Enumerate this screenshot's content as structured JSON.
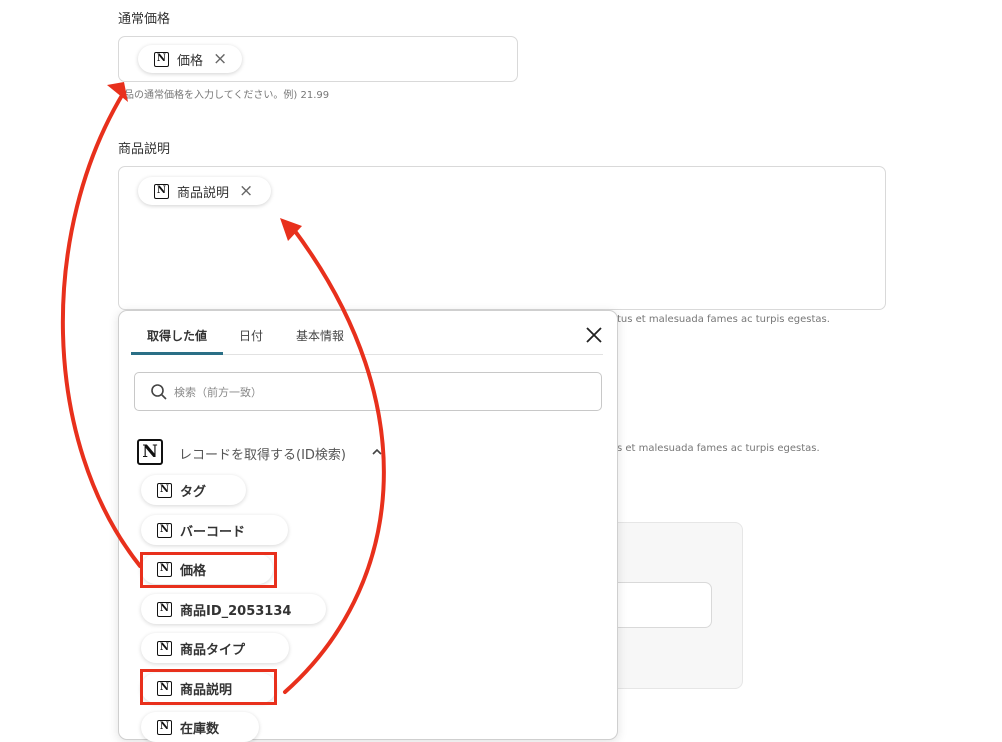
{
  "price_field": {
    "label": "通常価格",
    "chip": "価格",
    "hint": "品の通常価格を入力してください。例) 21.99"
  },
  "description_field": {
    "label": "商品説明",
    "chip": "商品説明",
    "hint": "tus et malesuada fames ac turpis egestas."
  },
  "background_hint_2": "s et malesuada fames ac turpis egestas.",
  "panel": {
    "tabs": [
      "取得した値",
      "日付",
      "基本情報"
    ],
    "search_placeholder": "検索（前方一致）",
    "section_title": "レコードを取得する(ID検索)",
    "items": [
      "タグ",
      "バーコード",
      "価格",
      "商品ID_2053134",
      "商品タイプ",
      "商品説明",
      "在庫数"
    ]
  },
  "icons": {
    "notion": "N",
    "close": "×",
    "search": "search-icon",
    "chevron": "chevron-up-icon"
  },
  "colors": {
    "accent_tab": "#2a6f86",
    "annotation": "#e8301c"
  }
}
